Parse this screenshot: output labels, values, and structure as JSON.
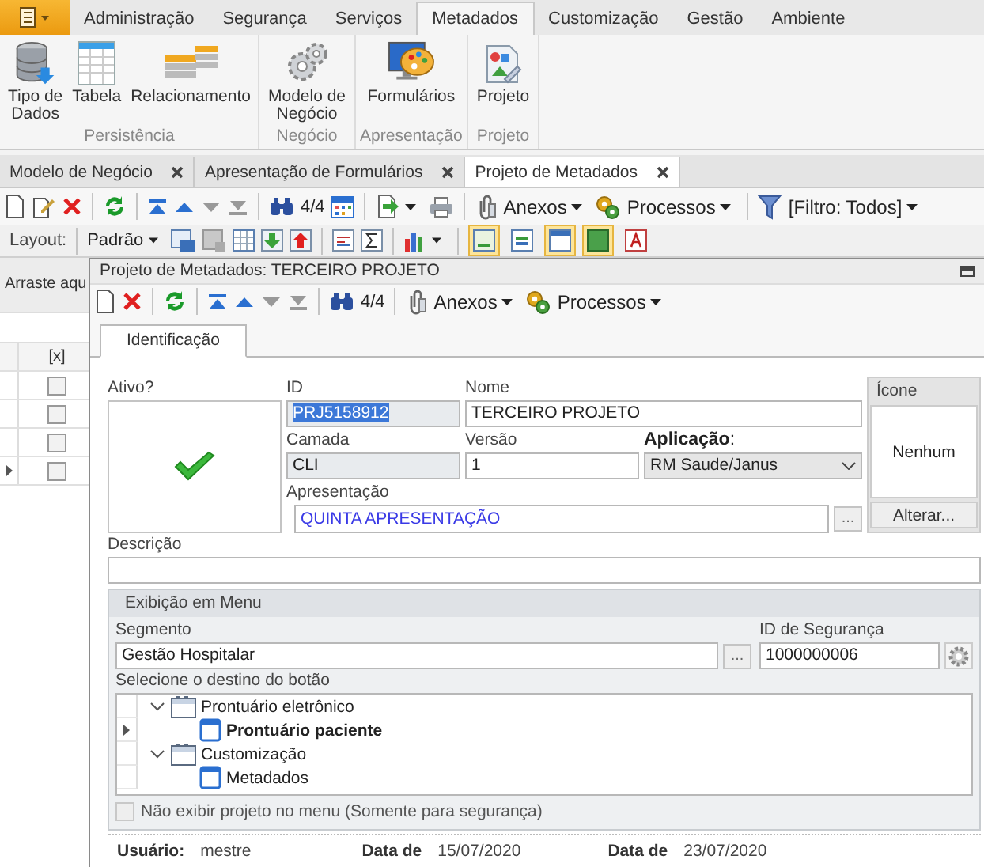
{
  "ribbon": {
    "tabs": [
      {
        "label": "Administração",
        "selected": false
      },
      {
        "label": "Segurança",
        "selected": false
      },
      {
        "label": "Serviços",
        "selected": false
      },
      {
        "label": "Metadados",
        "selected": true
      },
      {
        "label": "Customização",
        "selected": false
      },
      {
        "label": "Gestão",
        "selected": false
      },
      {
        "label": "Ambiente",
        "selected": false
      }
    ],
    "groups": [
      {
        "label": "Persistência",
        "buttons": [
          "Tipo de\nDados",
          "Tabela",
          "Relacionamento"
        ]
      },
      {
        "label": "Negócio",
        "buttons": [
          "Modelo de\nNegócio"
        ]
      },
      {
        "label": "Apresentação",
        "buttons": [
          "Formulários"
        ]
      },
      {
        "label": "Projeto",
        "buttons": [
          "Projeto"
        ]
      }
    ]
  },
  "document_tabs": [
    {
      "label": "Modelo de Negócio",
      "selected": false
    },
    {
      "label": "Apresentação de Formulários",
      "selected": false
    },
    {
      "label": "Projeto de Metadados",
      "selected": true
    }
  ],
  "toolbar": {
    "counter": "4/4",
    "attachments": "Anexos",
    "processes": "Processos",
    "filter": "[Filtro: Todos]"
  },
  "layout_bar": {
    "label": "Layout:",
    "preset": "Padrão",
    "toggles": [
      {
        "on": true
      },
      {
        "on": false
      },
      {
        "on": true
      },
      {
        "on": true
      },
      {
        "on": false
      }
    ]
  },
  "grid": {
    "group_hint": "Arraste aqu",
    "column": "[x]",
    "rows": [
      {
        "checked": false,
        "selected": false
      },
      {
        "checked": false,
        "selected": false
      },
      {
        "checked": false,
        "selected": false
      },
      {
        "checked": false,
        "selected": true
      }
    ]
  },
  "dialog": {
    "title": "Projeto de Metadados: TERCEIRO PROJETO",
    "toolbar": {
      "counter": "4/4",
      "attachments": "Anexos",
      "processes": "Processos"
    },
    "tabs": [
      {
        "label": "Identificação",
        "selected": true
      }
    ],
    "active": {
      "label": "Ativo?",
      "checked": true
    },
    "id": {
      "label": "ID",
      "value": "PRJ5158912",
      "readonly": true,
      "highlighted": true
    },
    "name": {
      "label": "Nome",
      "value": "TERCEIRO PROJETO",
      "readonly": false
    },
    "layer": {
      "label": "Camada",
      "value": "CLI",
      "readonly": true
    },
    "version": {
      "label": "Versão",
      "value": "1",
      "readonly": false
    },
    "application": {
      "label": "**Aplicação**:",
      "value": "RM Saude/Janus"
    },
    "presentation": {
      "label": "Apresentação",
      "value": "QUINTA APRESENTAÇÃO",
      "button": "..."
    },
    "icon_panel": {
      "title": "Ícone",
      "value": "Nenhum",
      "button": "Alterar..."
    },
    "description": {
      "label": "Descrição"
    },
    "menu": {
      "title": "Exibição em Menu",
      "segment": {
        "label": "Segmento",
        "value": "Gestão Hospitalar",
        "button": "..."
      },
      "security_id": {
        "label": "ID de Segurança",
        "value": "1000000006"
      },
      "tree_label": "Selecione o destino do botão",
      "tree": [
        {
          "label": "Prontuário eletrônico",
          "expanded": true,
          "selected": false,
          "children": [
            {
              "label": "Prontuário paciente",
              "selected": true
            }
          ]
        },
        {
          "label": "Customização",
          "expanded": true,
          "selected": false,
          "children": [
            {
              "label": "Metadados",
              "selected": false
            }
          ]
        }
      ],
      "hide_option": {
        "label": "Não exibir projeto no menu (Somente para segurança)",
        "checked": false,
        "disabled": true
      }
    },
    "footer": [
      {
        "label": "Usuário:",
        "value": "mestre"
      },
      {
        "label": "Data de",
        "value": "15/07/2020"
      },
      {
        "label": "Data de",
        "value": "23/07/2020"
      }
    ]
  }
}
